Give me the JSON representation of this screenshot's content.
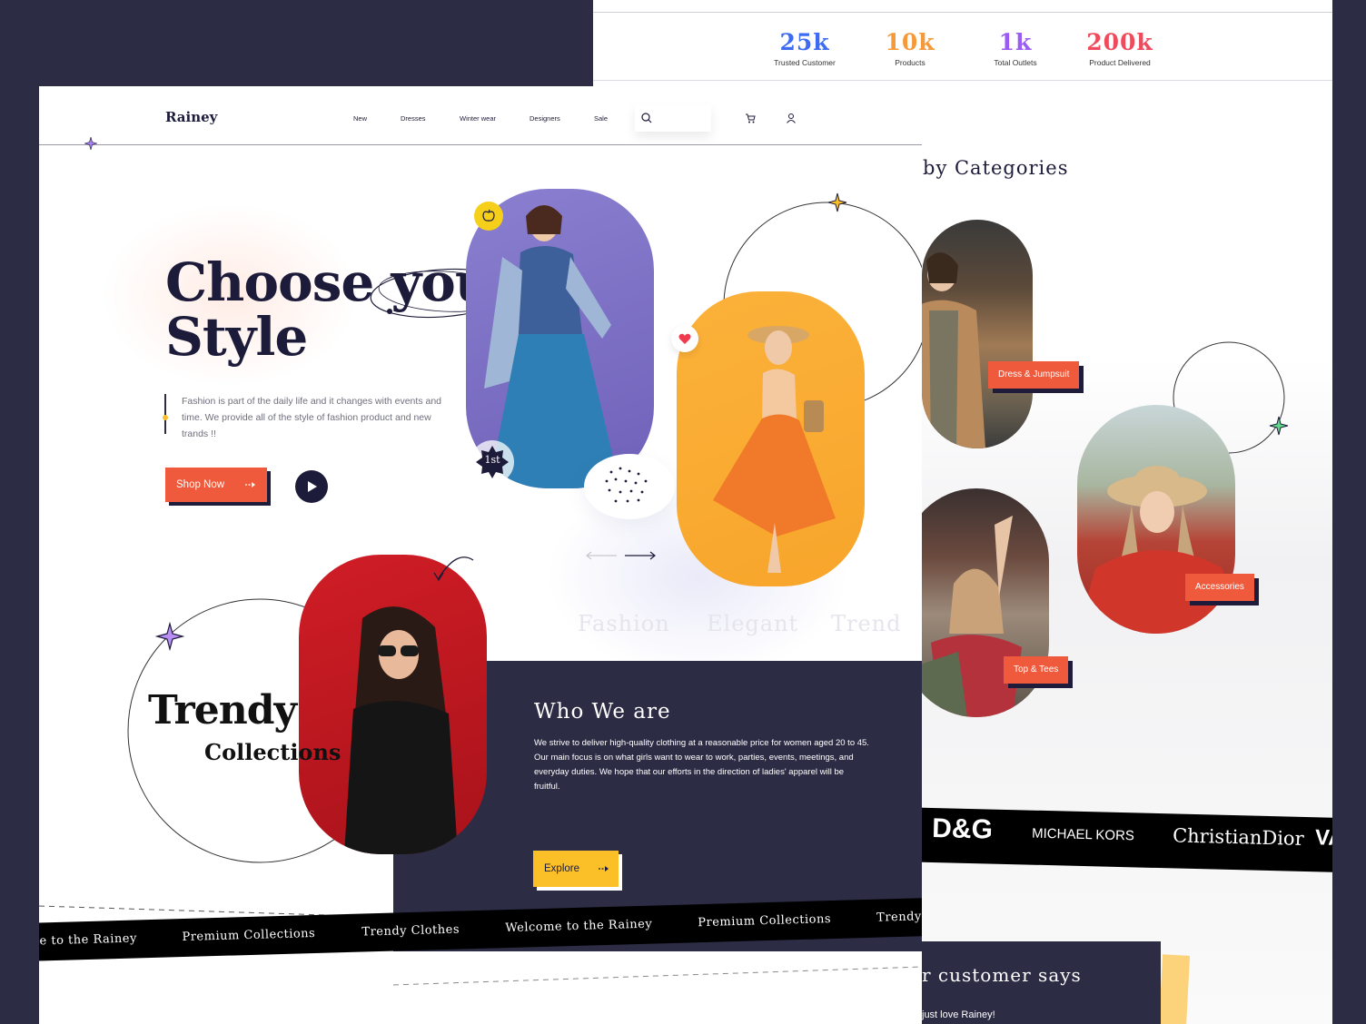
{
  "stats": [
    {
      "num": "25k",
      "label": "Trusted Customer",
      "color": "#3d6cf2"
    },
    {
      "num": "10k",
      "label": "Products",
      "color": "#f59a3b"
    },
    {
      "num": "1k",
      "label": "Total Outlets",
      "color": "#9a5cf5"
    },
    {
      "num": "200k",
      "label": "Product Delivered",
      "color": "#ef4b5c"
    }
  ],
  "categories": {
    "title": "by Categories",
    "tags": [
      "Dress & Jumpsuit",
      "Accessories",
      "Top & Tees"
    ]
  },
  "brands": [
    "D&G",
    "MICHAEL KORS",
    "ChristianDior",
    "VA"
  ],
  "testimonial": {
    "title": "r customer says",
    "quote": "just love Rainey!"
  },
  "nav": {
    "logo": "Rainey",
    "links": [
      "New",
      "Dresses",
      "Winter wear",
      "Designers",
      "Sale"
    ]
  },
  "hero": {
    "title_line1": "Choose your",
    "title_line2": "Style",
    "description": "Fashion is part of the daily life and it changes with events and time. We provide all of the style of fashion product and new trands !!",
    "shop_label": "Shop Now",
    "badge": "1st",
    "words": [
      "Fashion",
      "Elegant",
      "Trend"
    ]
  },
  "trendy": {
    "line1": "Trendy",
    "line2": "Collections"
  },
  "who": {
    "title": "Who We are",
    "text": "We strive to deliver high-quality clothing at a reasonable price for women aged 20 to 45. Our main focus is on what girls want to wear to work, parties, events, meetings, and everyday duties. We hope that our efforts in the direction of ladies' apparel will be fruitful.",
    "explore_label": "Explore"
  },
  "ribbon": [
    "e to the Rainey",
    "Premium Collections",
    "Trendy Clothes",
    "Welcome to the Rainey",
    "Premium Collections",
    "Trendy"
  ],
  "colors": {
    "dark": "#2c2c45",
    "accent": "#ef5a3c",
    "yellow": "#fbbf27"
  }
}
